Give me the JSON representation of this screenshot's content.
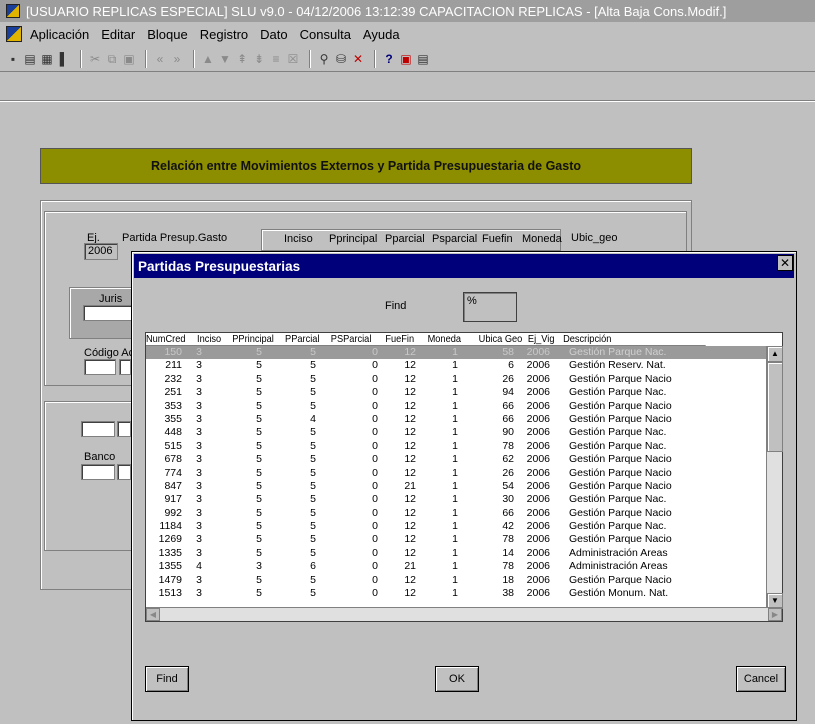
{
  "window": {
    "title": "[USUARIO REPLICAS ESPECIAL] SLU v9.0 - 04/12/2006 13:12:39 CAPACITACION REPLICAS - [Alta Baja Cons.Modif.]"
  },
  "menu": [
    "Aplicación",
    "Editar",
    "Bloque",
    "Registro",
    "Dato",
    "Consulta",
    "Ayuda"
  ],
  "form": {
    "heading": "Relación entre Movimientos Externos y Partida Presupuestaria de Gasto",
    "labels": {
      "ej": "Ej.",
      "partida": "Partida Presup.Gasto",
      "juris": "Juris",
      "codigo": "Código Act",
      "banco": "Banco"
    },
    "ej_value": "2006",
    "columns": [
      "Inciso",
      "Pprincipal",
      "Pparcial",
      "Psparcial",
      "Fuefin",
      "Moneda",
      "Ubic_geo"
    ]
  },
  "dialog": {
    "title": "Partidas Presupuestarias",
    "find_label": "Find",
    "find_value": "%",
    "columns": [
      "NumCred",
      "Inciso",
      "PPrincipal",
      "PParcial",
      "PSParcial",
      "FueFin",
      "Moneda",
      "Ubica Geo",
      "Ej_Vig",
      "Descripción"
    ],
    "rows": [
      {
        "num": "150",
        "inc": "3",
        "pp": "5",
        "pa": "5",
        "ps": "0",
        "ff": "12",
        "mo": "1",
        "ub": "58",
        "ej": "2006",
        "desc": "Gestión Parque Nac."
      },
      {
        "num": "211",
        "inc": "3",
        "pp": "5",
        "pa": "5",
        "ps": "0",
        "ff": "12",
        "mo": "1",
        "ub": "6",
        "ej": "2006",
        "desc": "Gestión Reserv. Nat."
      },
      {
        "num": "232",
        "inc": "3",
        "pp": "5",
        "pa": "5",
        "ps": "0",
        "ff": "12",
        "mo": "1",
        "ub": "26",
        "ej": "2006",
        "desc": "Gestión Parque Nacio"
      },
      {
        "num": "251",
        "inc": "3",
        "pp": "5",
        "pa": "5",
        "ps": "0",
        "ff": "12",
        "mo": "1",
        "ub": "94",
        "ej": "2006",
        "desc": "Gestión Parque Nac."
      },
      {
        "num": "353",
        "inc": "3",
        "pp": "5",
        "pa": "5",
        "ps": "0",
        "ff": "12",
        "mo": "1",
        "ub": "66",
        "ej": "2006",
        "desc": "Gestión Parque Nacio"
      },
      {
        "num": "355",
        "inc": "3",
        "pp": "5",
        "pa": "4",
        "ps": "0",
        "ff": "12",
        "mo": "1",
        "ub": "66",
        "ej": "2006",
        "desc": "Gestión Parque Nacio"
      },
      {
        "num": "448",
        "inc": "3",
        "pp": "5",
        "pa": "5",
        "ps": "0",
        "ff": "12",
        "mo": "1",
        "ub": "90",
        "ej": "2006",
        "desc": "Gestión Parque Nac."
      },
      {
        "num": "515",
        "inc": "3",
        "pp": "5",
        "pa": "5",
        "ps": "0",
        "ff": "12",
        "mo": "1",
        "ub": "78",
        "ej": "2006",
        "desc": "Gestión Parque Nac."
      },
      {
        "num": "678",
        "inc": "3",
        "pp": "5",
        "pa": "5",
        "ps": "0",
        "ff": "12",
        "mo": "1",
        "ub": "62",
        "ej": "2006",
        "desc": "Gestión Parque Nacio"
      },
      {
        "num": "774",
        "inc": "3",
        "pp": "5",
        "pa": "5",
        "ps": "0",
        "ff": "12",
        "mo": "1",
        "ub": "26",
        "ej": "2006",
        "desc": "Gestión Parque Nacio"
      },
      {
        "num": "847",
        "inc": "3",
        "pp": "5",
        "pa": "5",
        "ps": "0",
        "ff": "21",
        "mo": "1",
        "ub": "54",
        "ej": "2006",
        "desc": "Gestión Parque Nacio"
      },
      {
        "num": "917",
        "inc": "3",
        "pp": "5",
        "pa": "5",
        "ps": "0",
        "ff": "12",
        "mo": "1",
        "ub": "30",
        "ej": "2006",
        "desc": "Gestión Parque Nac."
      },
      {
        "num": "992",
        "inc": "3",
        "pp": "5",
        "pa": "5",
        "ps": "0",
        "ff": "12",
        "mo": "1",
        "ub": "66",
        "ej": "2006",
        "desc": "Gestión Parque Nacio"
      },
      {
        "num": "1184",
        "inc": "3",
        "pp": "5",
        "pa": "5",
        "ps": "0",
        "ff": "12",
        "mo": "1",
        "ub": "42",
        "ej": "2006",
        "desc": "Gestión Parque Nac."
      },
      {
        "num": "1269",
        "inc": "3",
        "pp": "5",
        "pa": "5",
        "ps": "0",
        "ff": "12",
        "mo": "1",
        "ub": "78",
        "ej": "2006",
        "desc": "Gestión Parque Nacio"
      },
      {
        "num": "1335",
        "inc": "3",
        "pp": "5",
        "pa": "5",
        "ps": "0",
        "ff": "12",
        "mo": "1",
        "ub": "14",
        "ej": "2006",
        "desc": "Administración Areas"
      },
      {
        "num": "1355",
        "inc": "4",
        "pp": "3",
        "pa": "6",
        "ps": "0",
        "ff": "21",
        "mo": "1",
        "ub": "78",
        "ej": "2006",
        "desc": "Administración Areas"
      },
      {
        "num": "1479",
        "inc": "3",
        "pp": "5",
        "pa": "5",
        "ps": "0",
        "ff": "12",
        "mo": "1",
        "ub": "18",
        "ej": "2006",
        "desc": "Gestión Parque Nacio"
      },
      {
        "num": "1513",
        "inc": "3",
        "pp": "5",
        "pa": "5",
        "ps": "0",
        "ff": "12",
        "mo": "1",
        "ub": "38",
        "ej": "2006",
        "desc": "Gestión Monum. Nat."
      }
    ],
    "buttons": {
      "find": "Find",
      "ok": "OK",
      "cancel": "Cancel"
    }
  },
  "icons": {
    "close": "close-icon",
    "scroll_up": "arrow-up-icon",
    "scroll_down": "arrow-down-icon",
    "scroll_left": "arrow-left-icon",
    "scroll_right": "arrow-right-icon"
  },
  "colors": {
    "banner": "#8d8d00",
    "dialog_title": "#00007a",
    "window_title": "#9e9e9e"
  }
}
